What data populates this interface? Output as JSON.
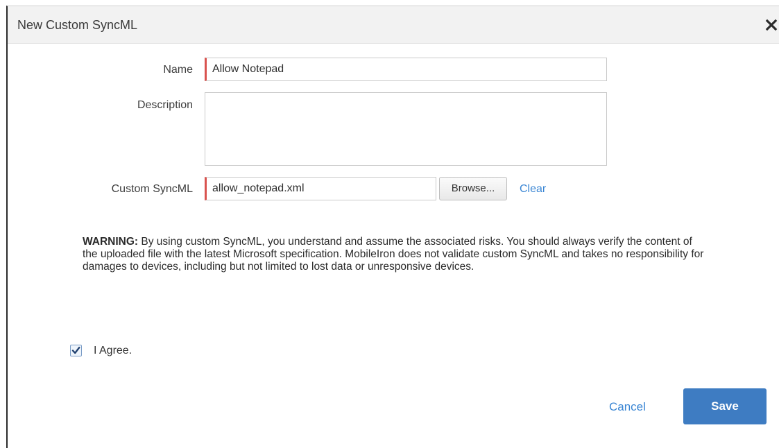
{
  "dialog": {
    "title": "New Custom SyncML"
  },
  "form": {
    "name_label": "Name",
    "name_value": "Allow Notepad",
    "description_label": "Description",
    "description_value": "",
    "syncml_label": "Custom SyncML",
    "syncml_value": "allow_notepad.xml",
    "browse_label": "Browse...",
    "clear_label": "Clear"
  },
  "warning": {
    "heading": "WARNING:",
    "text": "By using custom SyncML, you understand and assume the associated risks. You should always verify the content of the uploaded file with the latest Microsoft specification. MobileIron does not validate custom SyncML and takes no responsibility for damages to devices, including but not limited to lost data or unresponsive devices."
  },
  "agree": {
    "label": "I Agree.",
    "checked": true
  },
  "footer": {
    "cancel_label": "Cancel",
    "save_label": "Save"
  },
  "colors": {
    "accent": "#3e7cc2",
    "link": "#3a86d4",
    "required_marker": "#d9534f"
  },
  "icons": {
    "close": "close-icon",
    "check": "checkmark-icon"
  }
}
